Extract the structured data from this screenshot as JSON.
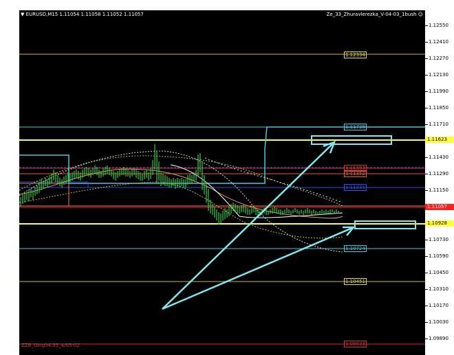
{
  "header": {
    "symbol_info": "EURUSD,M15  1.11054 1.11058 1.11052 1.11057",
    "indicator_name": "Ze_33_Zhuravlerezka_V-04-03_1bush",
    "smiley": "☺"
  },
  "footer": {
    "indicator_text": "ZZB_Ging04.95_4/05-02"
  },
  "axis_labels": [
    "1.12550",
    "1.12410",
    "1.12270",
    "1.12130",
    "1.11990",
    "1.11850",
    "1.11710",
    "1.11570",
    "1.11430",
    "1.11290",
    "1.11150",
    "1.11010",
    "1.10870",
    "1.10730",
    "1.10590",
    "1.10450",
    "1.10310",
    "1.10170",
    "1.10030",
    "1.09890"
  ],
  "axis_highlights": {
    "yellow": "1.11623",
    "price": "1.11057",
    "low_yellow": "1.10928"
  },
  "levels": [
    {
      "name": "level-112334",
      "text": "1.12334",
      "color": "#e8d84a"
    },
    {
      "name": "level-111738",
      "text": "1.11738",
      "color": "#48c8e0"
    },
    {
      "name": "level-111393",
      "text": "1.11393",
      "color": "#d03030"
    },
    {
      "name": "level-111352",
      "text": "1.11352",
      "color": "#e06040"
    },
    {
      "name": "level-111231",
      "text": "1.11231",
      "color": "#3050e0"
    },
    {
      "name": "level-110724",
      "text": "1.10724",
      "color": "#48c8e0"
    },
    {
      "name": "level-110451",
      "text": "1.10451",
      "color": "#e8d84a"
    },
    {
      "name": "level-109933",
      "text": "1.09933",
      "color": "#d03030"
    }
  ],
  "colors": {
    "background": "#000000",
    "candles": "#2ecc40",
    "annotation": "#7fe8f0",
    "yellow": "#ffff40",
    "price_line": "#ff2020"
  }
}
